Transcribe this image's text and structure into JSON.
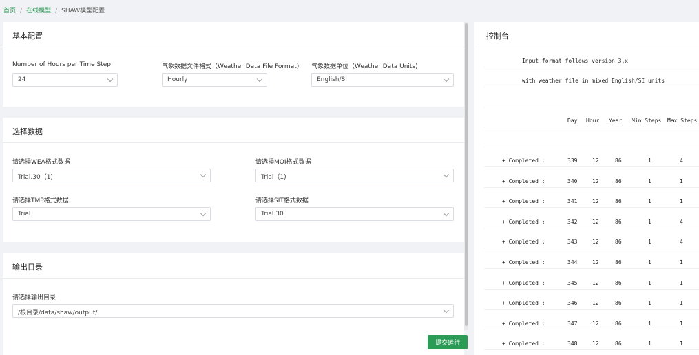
{
  "breadcrumb": {
    "home": "首页",
    "models": "在线模型",
    "current": "SHAW模型配置",
    "separator": "/"
  },
  "basic": {
    "title": "基本配置",
    "hours_label": "Number of Hours per Time Step",
    "hours_value": "24",
    "format_label": "气象数据文件格式（Weather Data File Format)",
    "format_value": "Hourly",
    "units_label": "气象数据单位（Weather Data Units)",
    "units_value": "English/SI"
  },
  "data": {
    "title": "选择数据",
    "wea_label": "请选择WEA格式数据",
    "wea_value": "Trial.30（1)",
    "moi_label": "请选择MOI格式数据",
    "moi_value": "Trial（1)",
    "tmp_label": "请选择TMP格式数据",
    "tmp_value": "Trial",
    "sit_label": "请选择SIT格式数据",
    "sit_value": "Trial.30"
  },
  "output": {
    "title": "输出目录",
    "dir_label": "请选择输出目录",
    "dir_value": "/根目录/data/shaw/output/"
  },
  "submit_label": "提交运行",
  "console": {
    "title": "控制台",
    "line1": "Input format follows version 3.x",
    "line2": "with weather file in mixed English/SI units",
    "headers": [
      "Day",
      "Hour",
      "Year",
      "Min Steps",
      "Max Steps"
    ],
    "completed_label": "+ Completed :",
    "rows": [
      {
        "day": "339",
        "hour": "12",
        "year": "86",
        "min": "1",
        "max": "4"
      },
      {
        "day": "340",
        "hour": "12",
        "year": "86",
        "min": "1",
        "max": "1"
      },
      {
        "day": "341",
        "hour": "12",
        "year": "86",
        "min": "1",
        "max": "1"
      },
      {
        "day": "342",
        "hour": "12",
        "year": "86",
        "min": "1",
        "max": "4"
      },
      {
        "day": "343",
        "hour": "12",
        "year": "86",
        "min": "1",
        "max": "4"
      },
      {
        "day": "344",
        "hour": "12",
        "year": "86",
        "min": "1",
        "max": "1"
      },
      {
        "day": "345",
        "hour": "12",
        "year": "86",
        "min": "1",
        "max": "1"
      },
      {
        "day": "346",
        "hour": "12",
        "year": "86",
        "min": "1",
        "max": "1"
      },
      {
        "day": "347",
        "hour": "12",
        "year": "86",
        "min": "1",
        "max": "1"
      },
      {
        "day": "348",
        "hour": "12",
        "year": "86",
        "min": "1",
        "max": "1"
      }
    ]
  }
}
